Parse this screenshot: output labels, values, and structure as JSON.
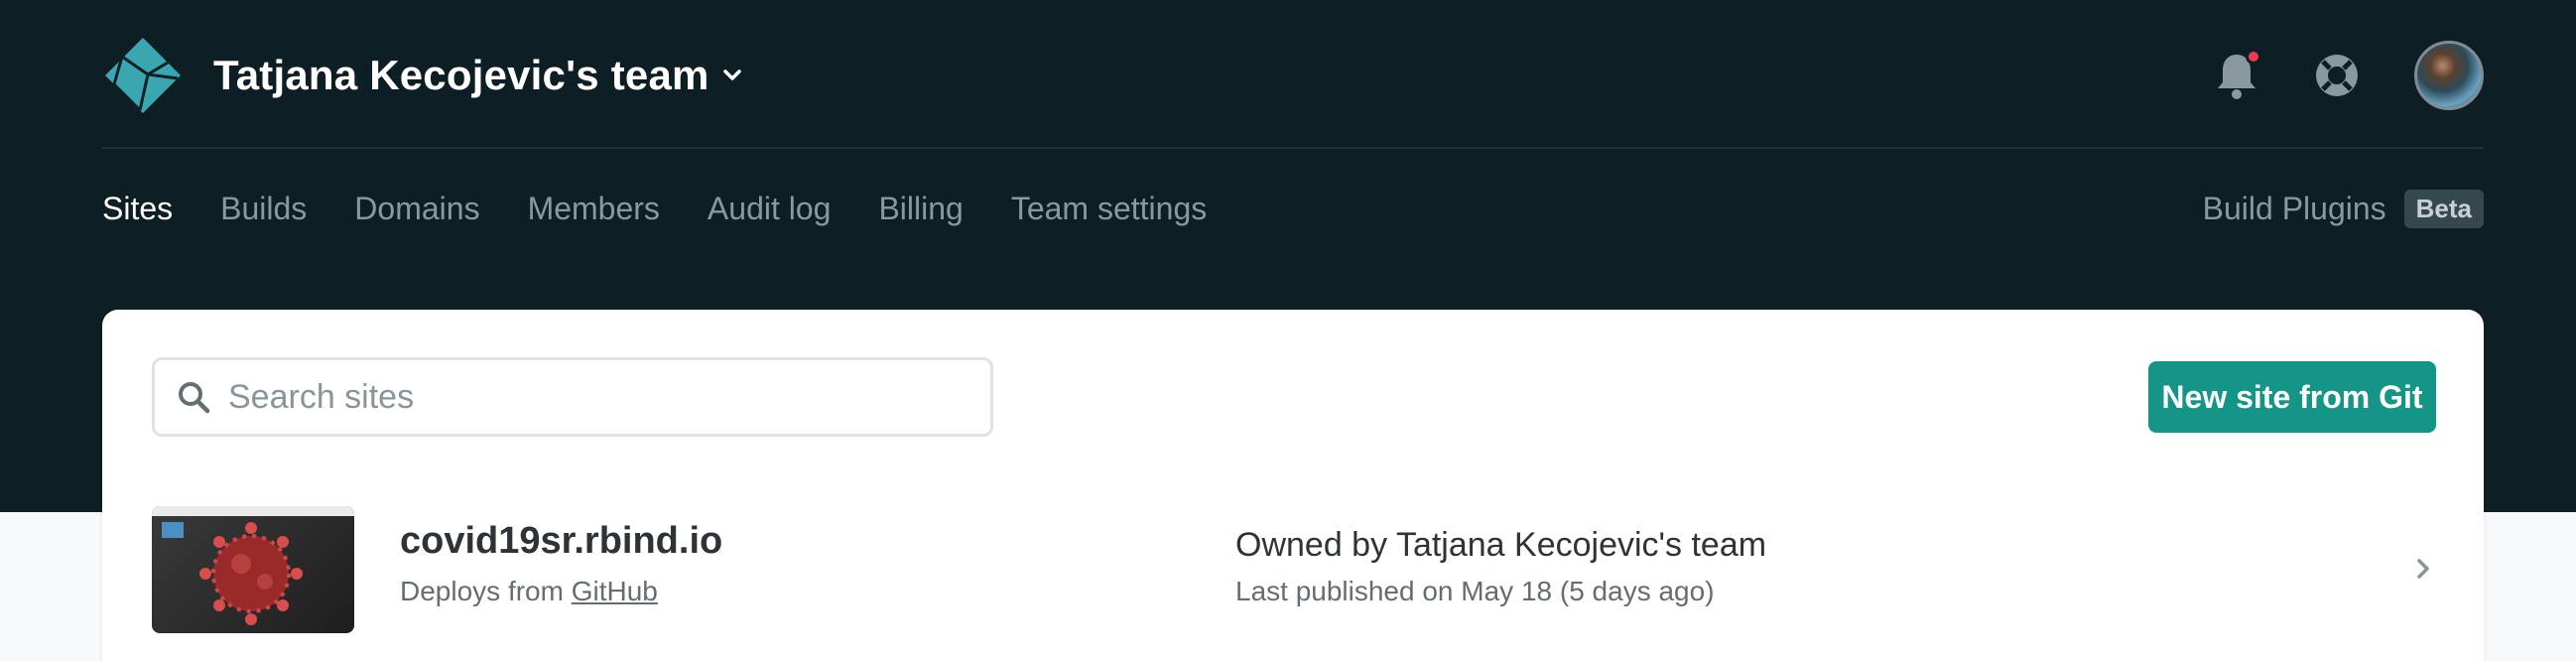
{
  "header": {
    "team_name": "Tatjana Kecojevic's team"
  },
  "nav": {
    "items": [
      {
        "label": "Sites",
        "active": true
      },
      {
        "label": "Builds",
        "active": false
      },
      {
        "label": "Domains",
        "active": false
      },
      {
        "label": "Members",
        "active": false
      },
      {
        "label": "Audit log",
        "active": false
      },
      {
        "label": "Billing",
        "active": false
      },
      {
        "label": "Team settings",
        "active": false
      }
    ],
    "build_plugins_label": "Build Plugins",
    "beta_badge": "Beta"
  },
  "search": {
    "placeholder": "Search sites"
  },
  "actions": {
    "new_site_label": "New site from Git"
  },
  "sites": [
    {
      "name": "covid19sr.rbind.io",
      "deploys_prefix": "Deploys from",
      "deploys_source": "GitHub",
      "owned_prefix": "Owned by",
      "owner": "Tatjana Kecojevic's team",
      "published": "Last published on May 18 (5 days ago)"
    }
  ],
  "colors": {
    "header_bg": "#0e1e25",
    "accent": "#159488",
    "notification": "#ee3b4c",
    "logo": "#3aa6b0"
  },
  "icons": {
    "logo": "netlify-logo-icon",
    "notifications": "bell-icon",
    "help": "lifebuoy-icon",
    "search": "search-icon",
    "team_menu": "chevron-down-icon",
    "row_open": "chevron-right-icon"
  }
}
